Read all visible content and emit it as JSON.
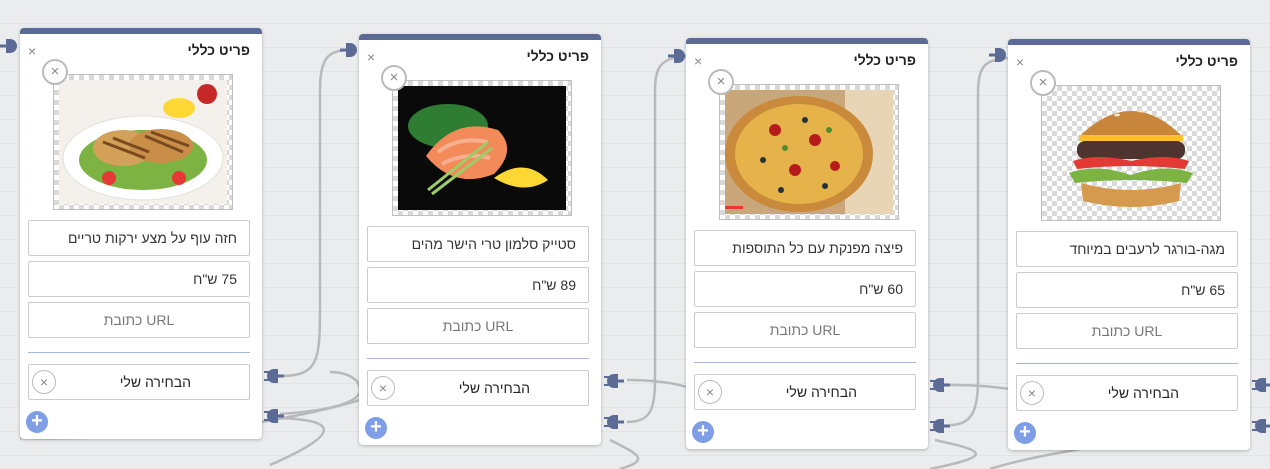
{
  "cards": [
    {
      "title": "פריט כללי",
      "name": "חזה עוף על מצע ירקות טריים",
      "price": "75 ש\"ח",
      "url_placeholder": "URL כתובת",
      "choice": "הבחירה שלי",
      "image_icon": "grilled-chicken-image"
    },
    {
      "title": "פריט כללי",
      "name": "סטייק סלמון טרי הישר מהים",
      "price": "89 ש\"ח",
      "url_placeholder": "URL כתובת",
      "choice": "הבחירה שלי",
      "image_icon": "salmon-steak-image"
    },
    {
      "title": "פריט כללי",
      "name": "פיצה מפנקת עם כל התוספות",
      "price": "60 ש\"ח",
      "url_placeholder": "URL כתובת",
      "choice": "הבחירה שלי",
      "image_icon": "pizza-image"
    },
    {
      "title": "פריט כללי",
      "name": "מגה-בורגר לרעבים במיוחד",
      "price": "65 ש\"ח",
      "url_placeholder": "URL כתובת",
      "choice": "הבחירה שלי",
      "image_icon": "burger-image"
    }
  ],
  "icons": {
    "close": "×",
    "add": "+"
  },
  "colors": {
    "header": "#5c6a96",
    "connector": "#5c6a96",
    "add_button": "#7f9ee6",
    "wire": "#b8b9bd"
  }
}
